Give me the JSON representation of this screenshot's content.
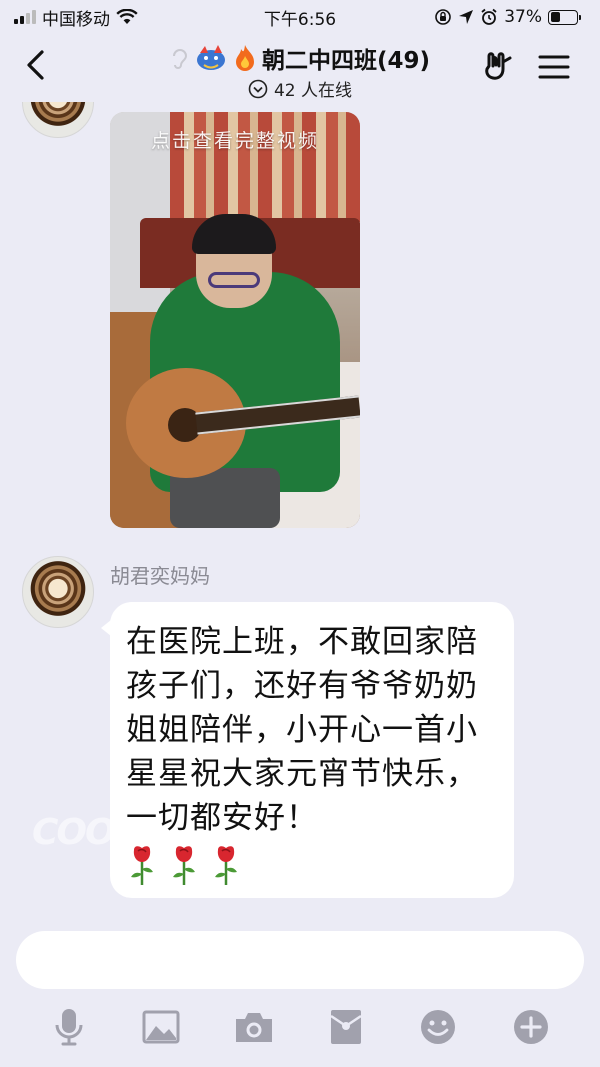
{
  "status_bar": {
    "carrier": "中国移动",
    "time": "下午6:56",
    "battery": "37%",
    "battery_level": 0.37
  },
  "header": {
    "title": "朝二中四班(49)",
    "online": "42 人在线"
  },
  "messages": [
    {
      "type": "video",
      "hint": "点击查看完整视频"
    },
    {
      "type": "text",
      "sender": "胡君奕妈妈",
      "text": "在医院上班，不敢回家陪孩子们，还好有爷爷奶奶姐姐陪伴，小开心一首小星星祝大家元宵节快乐，一切都安好！",
      "emoji_count": 3,
      "emoji_icon": "rose-icon"
    }
  ],
  "watermark": "COO",
  "input": {
    "value": "",
    "placeholder": ""
  },
  "toolbar": {
    "icons": [
      "microphone-icon",
      "image-icon",
      "camera-icon",
      "red-packet-icon",
      "emoji-icon",
      "plus-icon"
    ],
    "icon_color": "#a1a1ad"
  },
  "colors": {
    "background": "#ebebf5",
    "bubble": "#ffffff",
    "sender_name": "#8a8a93"
  }
}
